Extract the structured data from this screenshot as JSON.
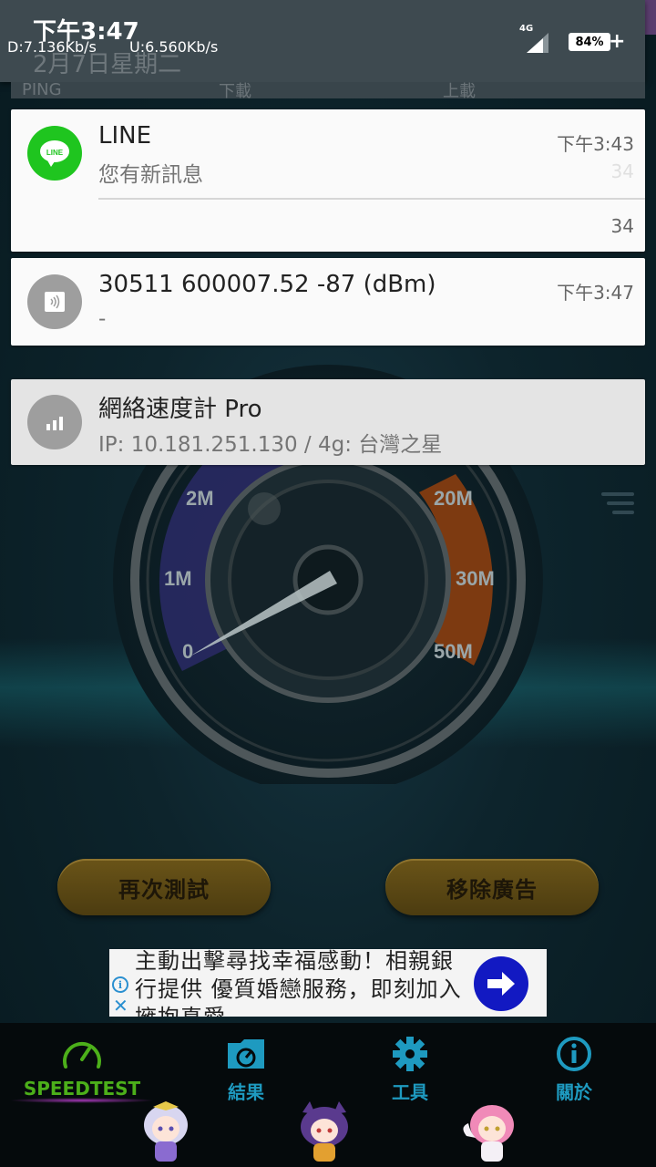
{
  "status_bar": {
    "time": "下午3:47",
    "download_speed": "D:7.136Kb/s",
    "upload_speed": "U:6.560Kb/s",
    "network_type": "4G",
    "battery": "84%"
  },
  "shade_header": {
    "date_ghost": "2月7日星期二",
    "col_ping": "PING",
    "col_download": "下載",
    "col_upload": "上載"
  },
  "notifications": [
    {
      "app": "LINE",
      "title": "LINE",
      "text": "您有新訊息",
      "time": "下午3:43",
      "ghost_count": "34",
      "count": "34",
      "icon": "line-app-icon",
      "icon_text": "LINE",
      "color": "#1fc51f"
    },
    {
      "title": "30511 600007.52 -87 (dBm)",
      "text": "-",
      "time": "下午3:47",
      "icon": "nfc-signal-icon",
      "color": "#9e9e9e"
    },
    {
      "title": "網絡速度計 Pro",
      "text": "IP: 10.181.251.130 / 4g: 台灣之星",
      "icon": "signal-bars-icon",
      "color": "#9e9e9e"
    }
  ],
  "gauge": {
    "labels": [
      "0",
      "1M",
      "2M",
      "20M",
      "30M",
      "50M"
    ]
  },
  "buttons": {
    "retest": "再次測試",
    "remove_ads": "移除廣告"
  },
  "ad": {
    "text": "主動出擊尋找幸福感動！相親銀行提供 優質婚戀服務，即刻加入擁抱真愛"
  },
  "nav": {
    "items": [
      {
        "label": "SPEEDTEST",
        "icon": "speedometer-icon",
        "active": true
      },
      {
        "label": "結果",
        "icon": "folder-gauge-icon",
        "active": false
      },
      {
        "label": "工具",
        "icon": "gear-icon",
        "active": false
      },
      {
        "label": "關於",
        "icon": "info-icon",
        "active": false
      }
    ]
  },
  "colors": {
    "active_nav": "#4caf1a",
    "inactive_nav": "#1e9ac0",
    "shade": "#3e4a50",
    "button_gold": "#5c4915"
  }
}
